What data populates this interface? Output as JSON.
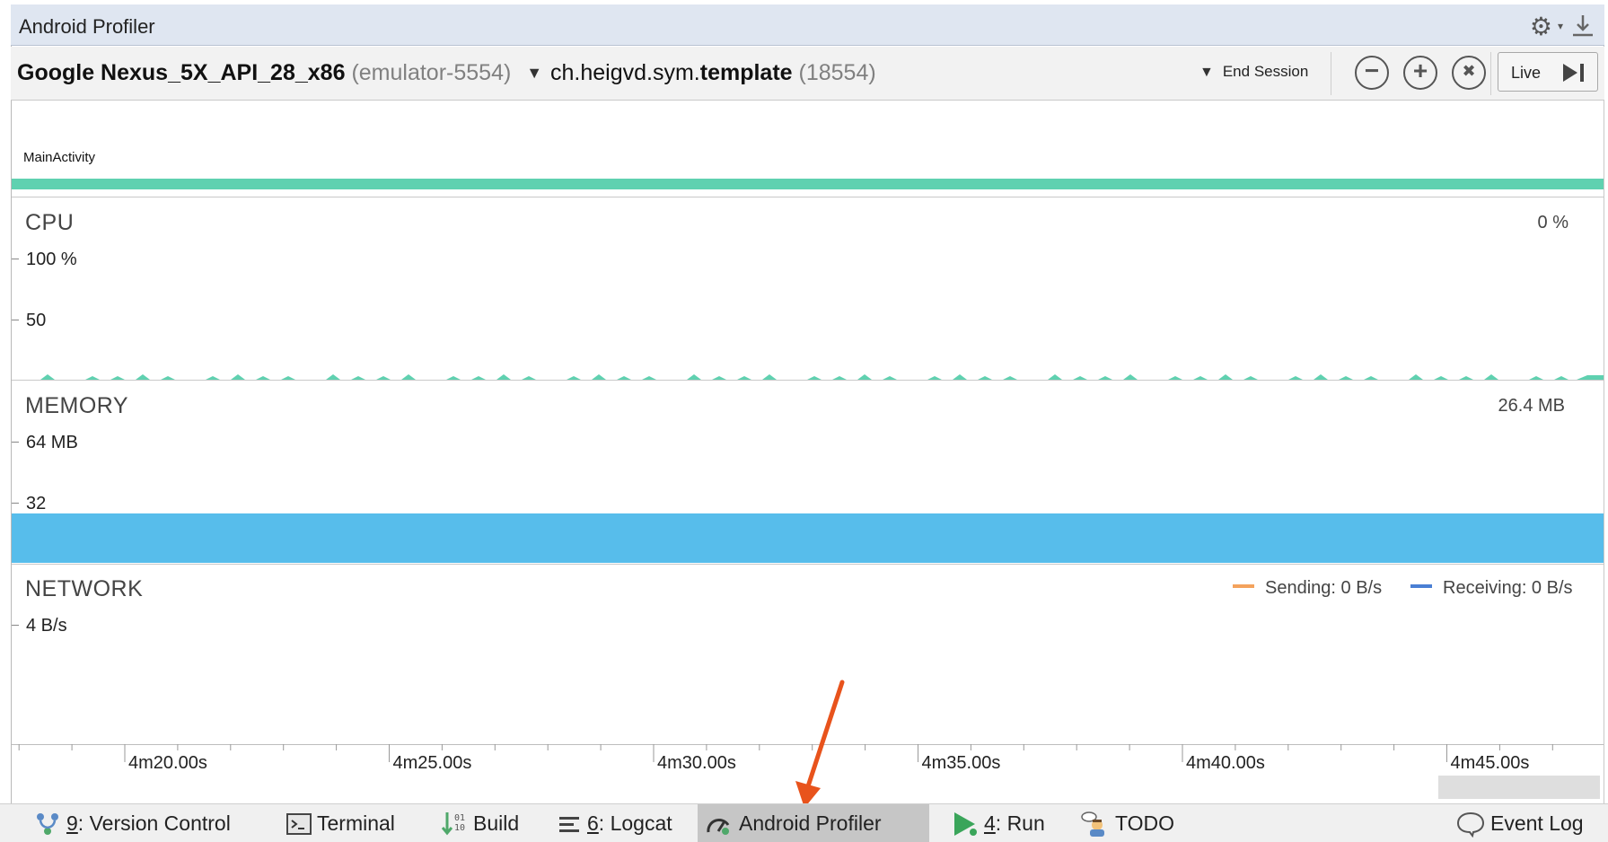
{
  "window": {
    "title": "Android Profiler"
  },
  "toolbar": {
    "device_name": "Google Nexus_5X_API_28_x86",
    "device_serial": "(emulator-5554)",
    "process_prefix": "ch.heigvd.sym.",
    "process_name": "template",
    "process_pid": "(18554)",
    "end_session_label": "End Session",
    "live_label": "Live"
  },
  "activity_lane": {
    "label": "MainActivity"
  },
  "cpu": {
    "label": "CPU",
    "current": "0 %",
    "axis_top": "100 %",
    "axis_mid": "50"
  },
  "memory": {
    "label": "MEMORY",
    "current": "26.4 MB",
    "axis_top": "64 MB",
    "axis_mid": "32",
    "level_fraction": 0.41
  },
  "network": {
    "label": "NETWORK",
    "axis_top": "4 B/s",
    "sending_label": "Sending: 0 B/s",
    "receiving_label": "Receiving: 0 B/s",
    "sending_color": "#f4a25d",
    "receiving_color": "#4a7fd4"
  },
  "timeline": {
    "ticks": [
      "4m20.00s",
      "4m25.00s",
      "4m30.00s",
      "4m35.00s",
      "4m40.00s",
      "4m45.00s"
    ]
  },
  "bottom_bar": {
    "version_control": {
      "number": "9",
      "label": ": Version Control"
    },
    "terminal": "Terminal",
    "build": "Build",
    "logcat": {
      "number": "6",
      "label": ": Logcat"
    },
    "android_profiler": "Android Profiler",
    "run": {
      "number": "4",
      "label": ": Run"
    },
    "todo": "TODO",
    "event_log": "Event Log"
  },
  "colors": {
    "cpu": "#5fd1b0",
    "memory": "#57bdeb",
    "arrow": "#e8531c",
    "titlebar": "#dfe6f1"
  }
}
